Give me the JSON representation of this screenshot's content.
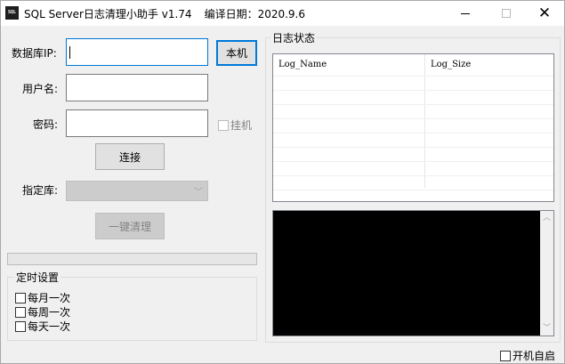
{
  "window": {
    "icon_text": "SQL",
    "title": "SQL Server日志清理小助手 v1.74",
    "build_date": "编译日期：2020.9.6"
  },
  "form": {
    "db_ip_label": "数据库IP:",
    "db_ip_value": "",
    "local_button": "本机",
    "username_label": "用户名:",
    "username_value": "",
    "password_label": "密码:",
    "password_value": "",
    "hang_label": "挂机",
    "connect_button": "连接",
    "database_label": "指定库:",
    "database_selected": "",
    "clean_button": "一键清理",
    "progress": 0
  },
  "schedule": {
    "title": "定时设置",
    "options": [
      "每月一次",
      "每周一次",
      "每天一次"
    ]
  },
  "log_panel": {
    "title": "日志状态",
    "columns": [
      "Log_Name",
      "Log_Size"
    ],
    "rows": []
  },
  "footer": {
    "autostart_label": "开机自启"
  }
}
